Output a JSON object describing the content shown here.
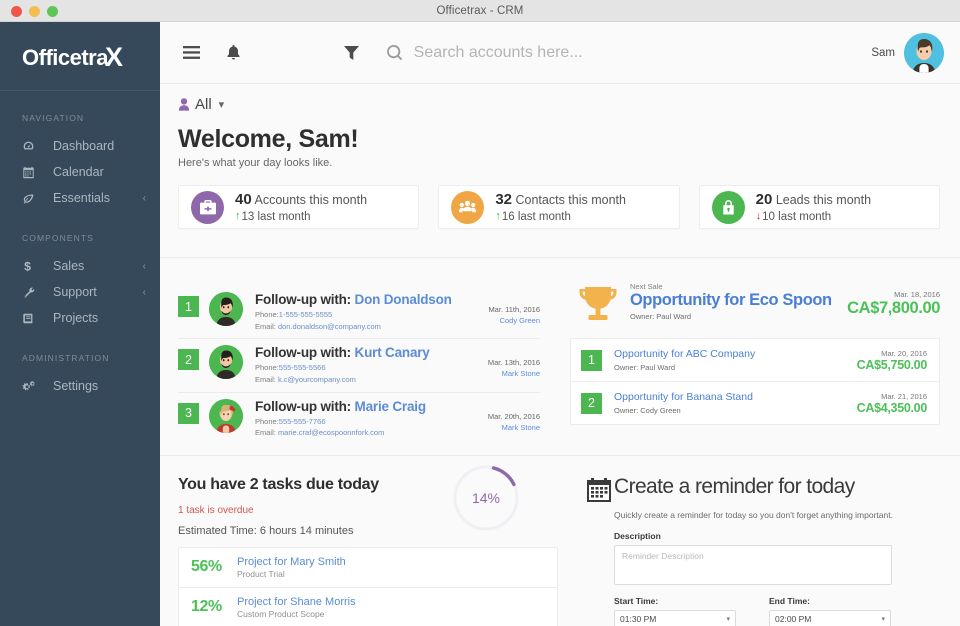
{
  "window": {
    "title": "Officetrax - CRM",
    "buttons": [
      "close",
      "minimize",
      "maximize"
    ]
  },
  "sidebar": {
    "logo_main": "Officetra",
    "logo_x": "X",
    "sections": [
      {
        "heading": "NAVIGATION",
        "items": [
          {
            "label": "Dashboard",
            "icon": "dashboard-icon",
            "caret": ""
          },
          {
            "label": "Calendar",
            "icon": "calendar-icon",
            "caret": ""
          },
          {
            "label": "Essentials",
            "icon": "leaf-icon",
            "caret": "‹"
          }
        ]
      },
      {
        "heading": "COMPONENTS",
        "items": [
          {
            "label": "Sales",
            "icon": "dollar-icon",
            "caret": "‹"
          },
          {
            "label": "Support",
            "icon": "wrench-icon",
            "caret": "‹"
          },
          {
            "label": "Projects",
            "icon": "book-icon",
            "caret": ""
          }
        ]
      },
      {
        "heading": "ADMINISTRATION",
        "items": [
          {
            "label": "Settings",
            "icon": "gears-icon",
            "caret": ""
          }
        ]
      }
    ]
  },
  "topbar": {
    "menu_icon": "hamburger-icon",
    "bell_icon": "bell-icon",
    "filter_icon": "funnel-icon",
    "search_icon": "search-icon",
    "search_placeholder": "Search accounts here...",
    "search_value": "",
    "user_name": "Sam",
    "avatar": "user-avatar"
  },
  "main": {
    "filter": {
      "label": "All",
      "icon": "person-icon",
      "caret": "⌄"
    },
    "welcome": {
      "title": "Welcome, Sam!",
      "subtitle": "Here's what your day looks like."
    },
    "stats": [
      {
        "number": "40",
        "label": "Accounts this month",
        "delta": "13 last month",
        "direction": "up",
        "arrow": "↑",
        "icon": "briefcase-icon",
        "color": "#8e68ab"
      },
      {
        "number": "32",
        "label": "Contacts this month",
        "delta": "16 last month",
        "direction": "up",
        "arrow": "↑",
        "icon": "people-icon",
        "color": "#f0a645"
      },
      {
        "number": "20",
        "label": "Leads this month",
        "delta": "10 last month",
        "direction": "down",
        "arrow": "↓",
        "icon": "lock-icon",
        "color": "#4cb750"
      }
    ],
    "followups": [
      {
        "rank": "1",
        "prefix": "Follow-up with:",
        "name": "Don Donaldson",
        "phone_label": "Phone:",
        "phone": "1-555-555-5555",
        "email_label": "Email:",
        "email": "don.donaldson@company.com",
        "date": "Mar. 11th, 2016",
        "owner": "Cody Green",
        "avatar": "avatar-man-beard"
      },
      {
        "rank": "2",
        "prefix": "Follow-up with:",
        "name": "Kurt Canary",
        "phone_label": "Phone:",
        "phone": "555-555-5566",
        "email_label": "Email:",
        "email": "k.c@yourcompany.com",
        "date": "Mar. 13th, 2016",
        "owner": "Mark Stone",
        "avatar": "avatar-man-beard"
      },
      {
        "rank": "3",
        "prefix": "Follow-up with:",
        "name": "Marie Craig",
        "phone_label": "Phone:",
        "phone": "555-555-7766",
        "email_label": "Email:",
        "email": "marie.craf@ecospoonnfork.com",
        "date": "Mar. 20th, 2016",
        "owner": "Mark Stone",
        "avatar": "avatar-woman-bow"
      }
    ],
    "opportunity_feature": {
      "kicker": "Next Sale",
      "title": "Opportunity for Eco Spoon",
      "owner": "Owner: Paul Ward",
      "date": "Mar. 18, 2016",
      "amount": "CA$7,800.00",
      "icon": "trophy-icon"
    },
    "opportunities": [
      {
        "rank": "1",
        "name": "Opportunity for ABC Company",
        "owner": "Owner: Paul Ward",
        "date": "Mar. 20, 2016",
        "amount": "CA$5,750.00"
      },
      {
        "rank": "2",
        "name": "Opportunity for Banana Stand",
        "owner": "Owner: Cody Green",
        "date": "Mar. 21, 2016",
        "amount": "CA$4,350.00"
      }
    ],
    "tasks": {
      "heading": "You have 2 tasks due today",
      "overdue": "1 task is overdue",
      "estimated": "Estimated Time: 6 hours 14 minutes",
      "donut_percent": "14%",
      "donut_value": 14,
      "donut_color": "#8e68ab",
      "items": [
        {
          "percent": "56%",
          "name": "Project for Mary Smith",
          "subtitle": "Product Trial"
        },
        {
          "percent": "12%",
          "name": "Project for Shane Morris",
          "subtitle": "Custom Product Scope"
        }
      ]
    },
    "reminder": {
      "icon": "calendar-icon",
      "title": "Create a reminder for today",
      "subtitle": "Quickly create a reminder for today so you don't forget anything important.",
      "description_label": "Description",
      "description_placeholder": "Reminder Description",
      "description_value": "",
      "start_label": "Start Time:",
      "start_value": "01:30 PM",
      "end_label": "End Time:",
      "end_value": "02:00 PM",
      "caret": "▾"
    }
  }
}
